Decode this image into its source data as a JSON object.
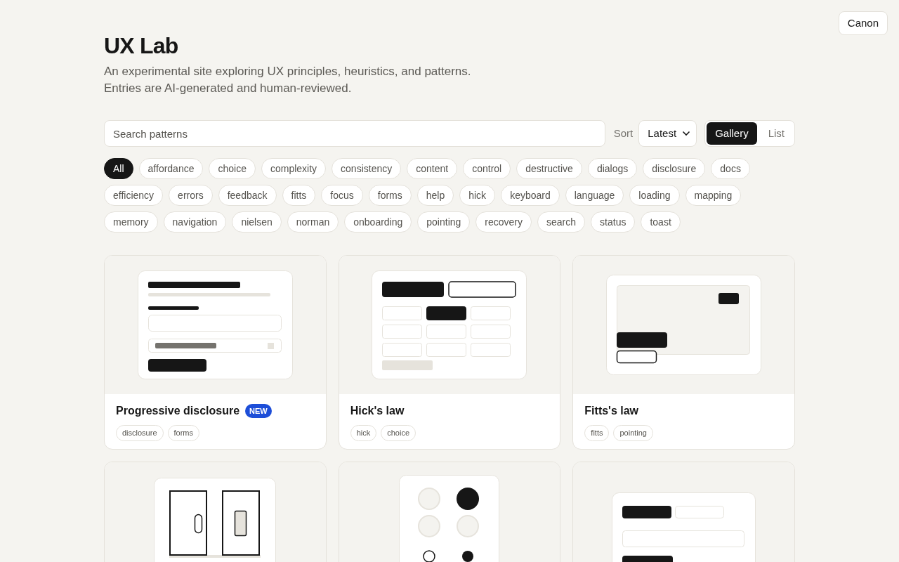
{
  "top_button": "Canon",
  "title": "UX Lab",
  "subtitle": "An experimental site exploring UX principles, heuristics, and patterns. Entries are AI-generated and human-reviewed.",
  "search": {
    "placeholder": "Search patterns"
  },
  "sort": {
    "label": "Sort",
    "value": "Latest"
  },
  "views": [
    {
      "label": "Gallery",
      "selected": true
    },
    {
      "label": "List",
      "selected": false
    }
  ],
  "filters": [
    {
      "label": "All",
      "selected": true
    },
    {
      "label": "affordance",
      "selected": false
    },
    {
      "label": "choice",
      "selected": false
    },
    {
      "label": "complexity",
      "selected": false
    },
    {
      "label": "consistency",
      "selected": false
    },
    {
      "label": "content",
      "selected": false
    },
    {
      "label": "control",
      "selected": false
    },
    {
      "label": "destructive",
      "selected": false
    },
    {
      "label": "dialogs",
      "selected": false
    },
    {
      "label": "disclosure",
      "selected": false
    },
    {
      "label": "docs",
      "selected": false
    },
    {
      "label": "efficiency",
      "selected": false
    },
    {
      "label": "errors",
      "selected": false
    },
    {
      "label": "feedback",
      "selected": false
    },
    {
      "label": "fitts",
      "selected": false
    },
    {
      "label": "focus",
      "selected": false
    },
    {
      "label": "forms",
      "selected": false
    },
    {
      "label": "help",
      "selected": false
    },
    {
      "label": "hick",
      "selected": false
    },
    {
      "label": "keyboard",
      "selected": false
    },
    {
      "label": "language",
      "selected": false
    },
    {
      "label": "loading",
      "selected": false
    },
    {
      "label": "mapping",
      "selected": false
    },
    {
      "label": "memory",
      "selected": false
    },
    {
      "label": "navigation",
      "selected": false
    },
    {
      "label": "nielsen",
      "selected": false
    },
    {
      "label": "norman",
      "selected": false
    },
    {
      "label": "onboarding",
      "selected": false
    },
    {
      "label": "pointing",
      "selected": false
    },
    {
      "label": "recovery",
      "selected": false
    },
    {
      "label": "search",
      "selected": false
    },
    {
      "label": "status",
      "selected": false
    },
    {
      "label": "toast",
      "selected": false
    }
  ],
  "cards": [
    {
      "kind": "form",
      "title": "Progressive disclosure",
      "badge": "NEW",
      "tags": [
        "disclosure",
        "forms"
      ]
    },
    {
      "kind": "grid",
      "title": "Hick's law",
      "tags": [
        "hick",
        "choice"
      ]
    },
    {
      "kind": "target",
      "title": "Fitts's law",
      "tags": [
        "fitts",
        "pointing"
      ]
    },
    {
      "kind": "doors"
    },
    {
      "kind": "dots"
    },
    {
      "kind": "stack"
    }
  ]
}
